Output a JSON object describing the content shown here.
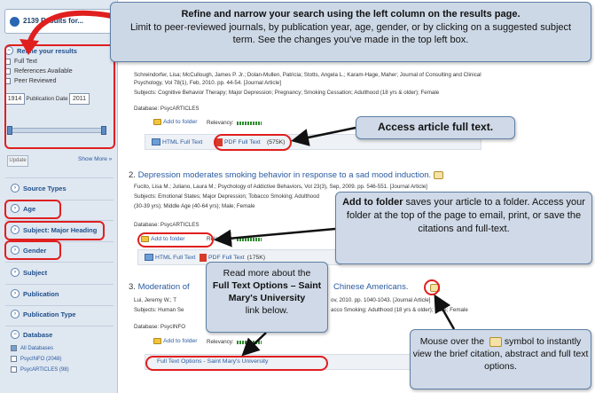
{
  "sidebar": {
    "search_count": "2139 Results for...",
    "refine": {
      "title": "Refine your results",
      "filters": [
        "Full Text",
        "References Available",
        "Peer Reviewed"
      ],
      "date_from": "1914",
      "date_label": "Publication Date",
      "date_to": "2011"
    },
    "update_label": "Update",
    "show_more": "Show More »",
    "facets": [
      "Source Types",
      "Age",
      "Subject: Major Heading",
      "Gender",
      "Subject",
      "Publication",
      "Publication Type",
      "Database"
    ],
    "databases": [
      "All Databases",
      "PsycINFO (2048)",
      "PsycARTICLES (98)"
    ]
  },
  "results": {
    "r1": {
      "authors_line": "Schreindorfer, Lisa; McCullough, James P. Jr.; Dolan-Mullen, Patricia; Stotts, Angela L.; Karam-Hage, Maher; Journal of Consulting and Clinical",
      "source_line": "Psychology, Vol 78(1), Feb, 2010. pp. 44-54. [Journal Article]",
      "subjects": "Subjects: Cognitive Behavior Therapy; Major Depression; Pregnancy; Smoking Cessation; Adulthood (18 yrs & older); Female",
      "database": "Database: PsycARTICLES",
      "add_folder": "Add to folder",
      "relevancy": "Relevancy:",
      "html_full_text": "HTML Full Text",
      "pdf_full_text": "PDF Full Text",
      "pdf_size": "(575K)"
    },
    "r2": {
      "number": "2.",
      "title": "Depression moderates smoking behavior in response to a sad mood induction.",
      "source": "Fucito, Lisa M.; Juliano, Laura M.; Psychology of Addictive Behaviors, Vol 23(3), Sep, 2009. pp. 546-551. [Journal Article]",
      "subjects": "Subjects: Emotional States; Major Depression; Tobacco Smoking; Adulthood",
      "ages": "(30-39 yrs); Middle Age (40-64 yrs); Male; Female",
      "database": "Database: PsycARTICLES",
      "add_folder": "Add to folder",
      "relevancy": "Relevancy:",
      "html_full_text": "HTML Full Text",
      "pdf_full_text": "PDF Full Text",
      "pdf_size": "(175K)"
    },
    "r3": {
      "number": "3.",
      "title_start": "Moderation of",
      "title_end": "Chinese Americans.",
      "authors": "Lui, Jeremy W.; T",
      "source_end": "ov, 2010. pp. 1040-1043. [Journal Article]",
      "subjects_start": "Subjects: Human Se",
      "subjects_end": "acco Smoking; Adulthood (18 yrs & older); Male; Female",
      "database": "Database: PsycINFO",
      "add_folder": "Add to folder",
      "relevancy": "Relevancy:",
      "ft_options": "Full Text Options - Saint Mary's University"
    }
  },
  "callouts": {
    "top_title": "Refine and narrow your search using the left column on the results page.",
    "top_body": "Limit to peer-reviewed journals, by publication year, age, gender, or by clicking on a suggested subject term. See the changes you've made in the top left box.",
    "full_text": "Access article full text.",
    "folder_bold": "Add to folder",
    "folder_text": " saves your article to a folder. Access your folder at the top of the page to email, print, or save the citations and full-text.",
    "ftopt_pre": "Read more about the",
    "ftopt_bold": "Full Text Options – Saint Mary's University",
    "ftopt_post": "link below.",
    "mouse_pre": "Mouse over the",
    "mouse_post": "symbol to instantly view the brief citation, abstract and full text options."
  }
}
